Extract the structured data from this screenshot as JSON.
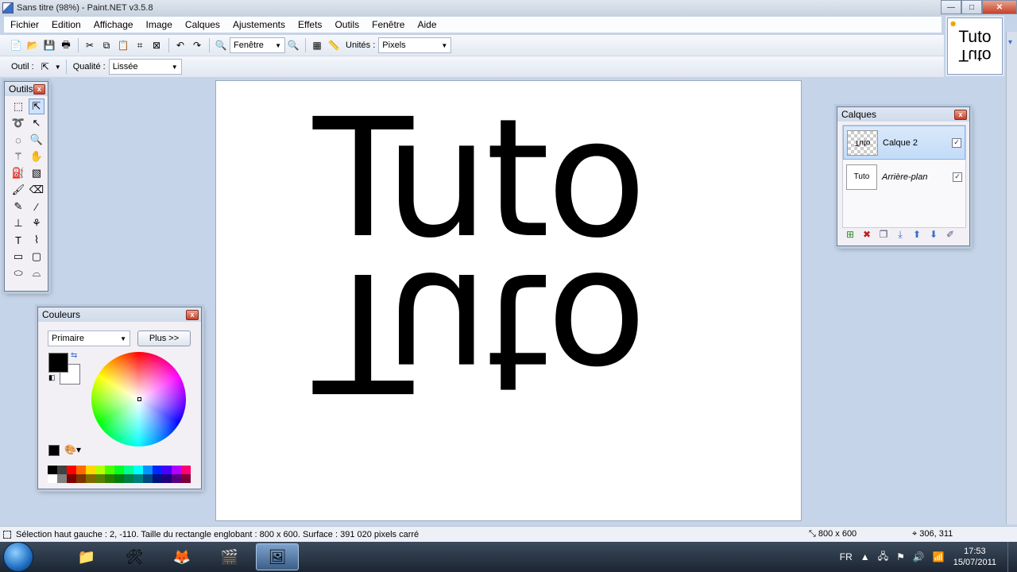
{
  "window": {
    "title": "Sans titre (98%) - Paint.NET v3.5.8",
    "minimize": "—",
    "maximize": "□",
    "close": "✕"
  },
  "menu": [
    "Fichier",
    "Edition",
    "Affichage",
    "Image",
    "Calques",
    "Ajustements",
    "Effets",
    "Outils",
    "Fenêtre",
    "Aide"
  ],
  "toolbar": {
    "zoom_value": "Fenêtre",
    "units_label": "Unités :",
    "units_value": "Pixels",
    "tool_label": "Outil :",
    "quality_label": "Qualité :",
    "quality_value": "Lissée"
  },
  "canvas": {
    "text": "Tuto",
    "text_mirrored": "Tuto"
  },
  "thumbnail": {
    "text": "Tuto",
    "text_mirrored": "Tuto"
  },
  "tools_window": {
    "title": "Outils",
    "close": "x"
  },
  "colors_window": {
    "title": "Couleurs",
    "close": "x",
    "mode_value": "Primaire",
    "more_button": "Plus >>",
    "primary_color": "#000000",
    "secondary_color": "#ffffff",
    "palette_top": [
      "#000000",
      "#404040",
      "#ff0000",
      "#ff6a00",
      "#ffd800",
      "#b6ff00",
      "#4cff00",
      "#00ff21",
      "#00ff90",
      "#00ffff",
      "#0094ff",
      "#0026ff",
      "#4800ff",
      "#b200ff",
      "#ff006e"
    ],
    "palette_bottom": [
      "#ffffff",
      "#808080",
      "#7f0000",
      "#7f3300",
      "#7f6a00",
      "#5b7f00",
      "#267f00",
      "#007f0e",
      "#007f46",
      "#007f7f",
      "#004a7f",
      "#00137f",
      "#21007f",
      "#57007f",
      "#7f0037"
    ]
  },
  "layers_window": {
    "title": "Calques",
    "close": "x",
    "layers": [
      {
        "name": "Calque 2",
        "thumb_text": "Tuto",
        "checked": "✓"
      },
      {
        "name": "Arrière-plan",
        "thumb_text": "Tuto",
        "checked": "✓"
      }
    ]
  },
  "status": {
    "text": "Sélection haut gauche : 2, -110. Taille du rectangle englobant : 800 x 600. Surface : 391 020 pixels carré",
    "size": "800 x 600",
    "position": "306, 311"
  },
  "taskbar": {
    "language": "FR",
    "time": "17:53",
    "date": "15/07/2011"
  }
}
